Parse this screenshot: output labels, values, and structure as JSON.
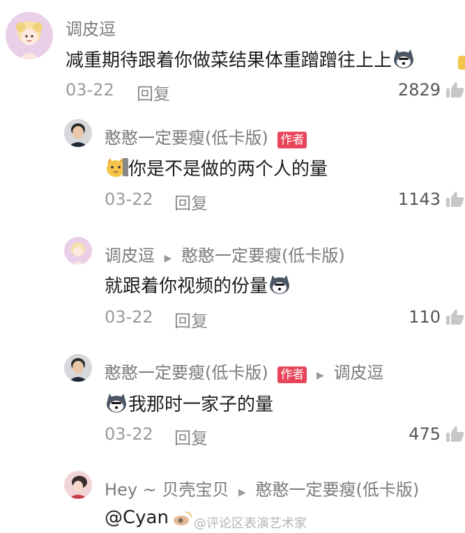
{
  "comments": [
    {
      "author": "调皮逗",
      "text": "减重期待跟着你做菜结果体重蹭蹭往上上",
      "date": "03-22",
      "reply_label": "回复",
      "likes": "2829"
    }
  ],
  "replies": [
    {
      "author": "憨憨一定要瘦(低卡版)",
      "badge": "作者",
      "text": "你是不是做的两个人的量",
      "date": "03-22",
      "reply_label": "回复",
      "likes": "1143"
    },
    {
      "author": "调皮逗",
      "reply_to": "憨憨一定要瘦(低卡版)",
      "text": "就跟着你视频的份量",
      "date": "03-22",
      "reply_label": "回复",
      "likes": "110"
    },
    {
      "author": "憨憨一定要瘦(低卡版)",
      "badge": "作者",
      "reply_to": "调皮逗",
      "text": "我那时一家子的量",
      "date": "03-22",
      "reply_label": "回复",
      "likes": "475"
    },
    {
      "author": "Hey ~ 贝壳宝贝",
      "reply_to": "憨憨一定要瘦(低卡版)",
      "text": "@Cyan"
    }
  ],
  "watermark": "@评论区表演艺术家",
  "colors": {
    "badge": "#e8455a",
    "meta": "#9a9a9a",
    "text": "#1d1d1d"
  }
}
